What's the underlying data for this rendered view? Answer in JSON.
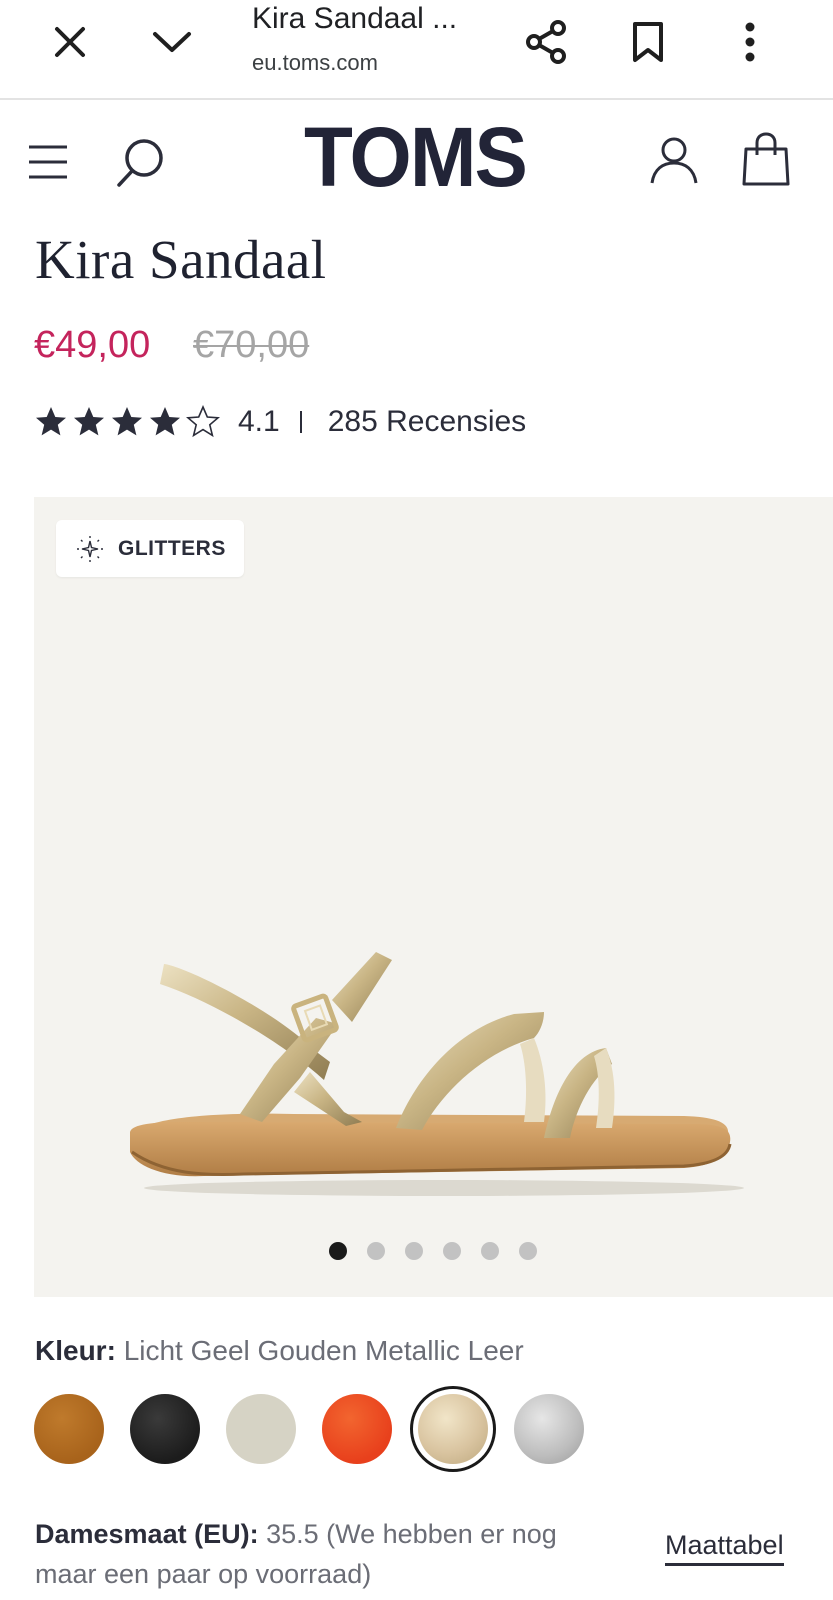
{
  "browser": {
    "tab_title": "Kira Sandaal ...",
    "url": "eu.toms.com",
    "icons": [
      "close-icon",
      "chevron-down-icon",
      "share-icon",
      "bookmark-icon",
      "more-vert-icon"
    ]
  },
  "header": {
    "logo": "TOMS",
    "icons": [
      "menu-icon",
      "search-icon",
      "account-icon",
      "cart-icon"
    ]
  },
  "product": {
    "title": "Kira Sandaal",
    "price_sale": "€49,00",
    "price_original": "€70,00",
    "rating": 4.1,
    "rating_text": "4.1",
    "stars_filled": 4,
    "stars_total": 5,
    "review_count": "285 Recensies",
    "badge": "GLITTERS",
    "gallery_count": 6,
    "gallery_active": 1
  },
  "color": {
    "label": "Kleur:",
    "value": "Licht Geel Gouden Metallic Leer",
    "swatches": [
      "#a8631b",
      "#1c1c1c",
      "#d6d3c5",
      "#e8401c",
      "#d9c4a0",
      "#bdbdbd"
    ],
    "selected_index": 4
  },
  "size": {
    "label": "Damesmaat (EU):",
    "value": "35.5 (We hebben er nog maar een paar op voorraad)",
    "chart_link": "Maattabel"
  },
  "colors": {
    "accent_sale": "#c4245c",
    "text_dark": "#1f2230",
    "gallery_bg": "#f4f3ef"
  }
}
